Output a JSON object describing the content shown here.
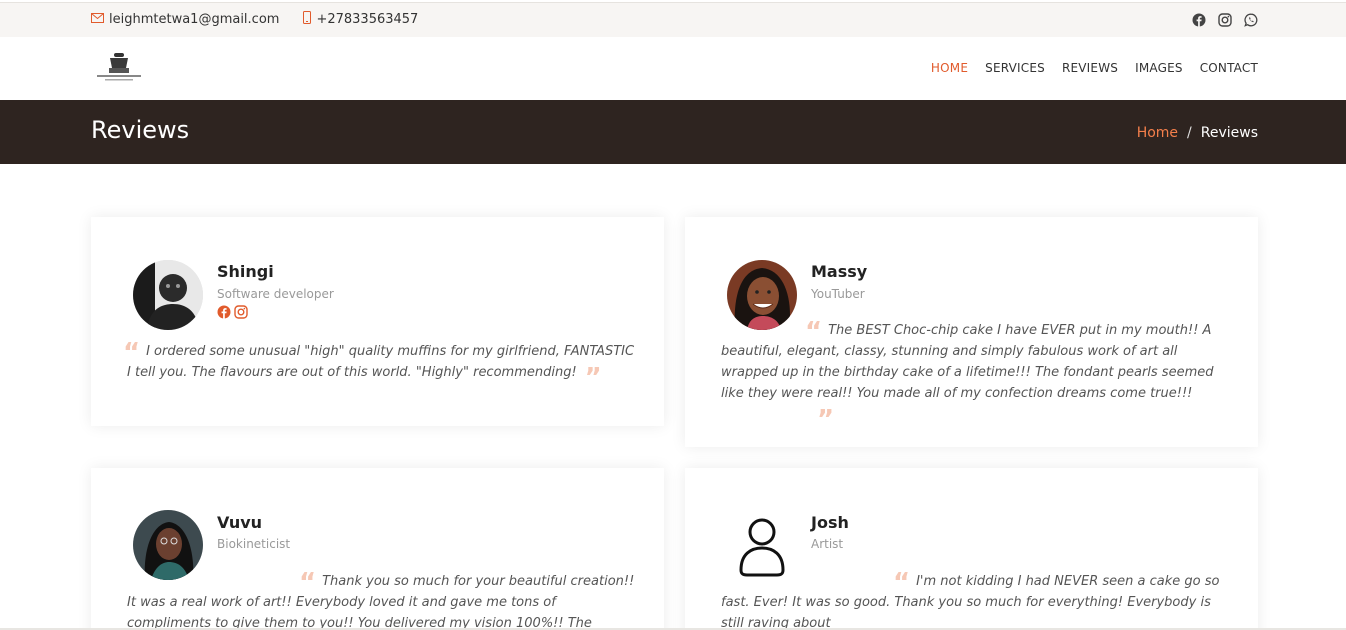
{
  "topbar": {
    "email": "leighmtetwa1@gmail.com",
    "phone": "+27833563457",
    "social_icons": [
      "facebook-icon",
      "instagram-icon",
      "whatsapp-icon"
    ]
  },
  "colors": {
    "accent": "#e15b2c",
    "banner_bg": "#2e2420",
    "crumb_home": "#f47f4b",
    "quote_mark": "#f6c8b5"
  },
  "nav": {
    "home": "HOME",
    "services": "SERVICES",
    "reviews": "REVIEWS",
    "images": "IMAGES",
    "contact": "CONTACT"
  },
  "banner": {
    "title": "Reviews",
    "crumb_home": "Home",
    "crumb_sep": "/",
    "crumb_current": "Reviews"
  },
  "reviews": [
    {
      "name": "Shingi",
      "role": "Software developer",
      "text": "I ordered some unusual \"high\" quality muffins for my girlfriend, FANTASTIC I tell you. The flavours are out of this world. \"Highly\" recommending!"
    },
    {
      "name": "Massy",
      "role": "YouTuber",
      "text": "The BEST Choc-chip cake I have EVER put in my mouth!! A beautiful, elegant, classy, stunning and simply fabulous work of art all wrapped up in the birthday cake of a lifetime!!! The fondant pearls seemed like they were real!! You made all of my confection dreams come true!!!"
    },
    {
      "name": "Vuvu",
      "role": "Biokineticist",
      "text": "Thank you so much for your beautiful creation!! It was a real work of art!! Everybody loved it and gave me tons of compliments to give them to you!! You delivered my vision 100%!! The combination of chocolate and"
    },
    {
      "name": "Josh",
      "role": "Artist",
      "text": "I'm not kidding I had NEVER seen a cake go so fast. Ever! It was so good. Thank you so much for everything! Everybody is still raving about"
    }
  ]
}
